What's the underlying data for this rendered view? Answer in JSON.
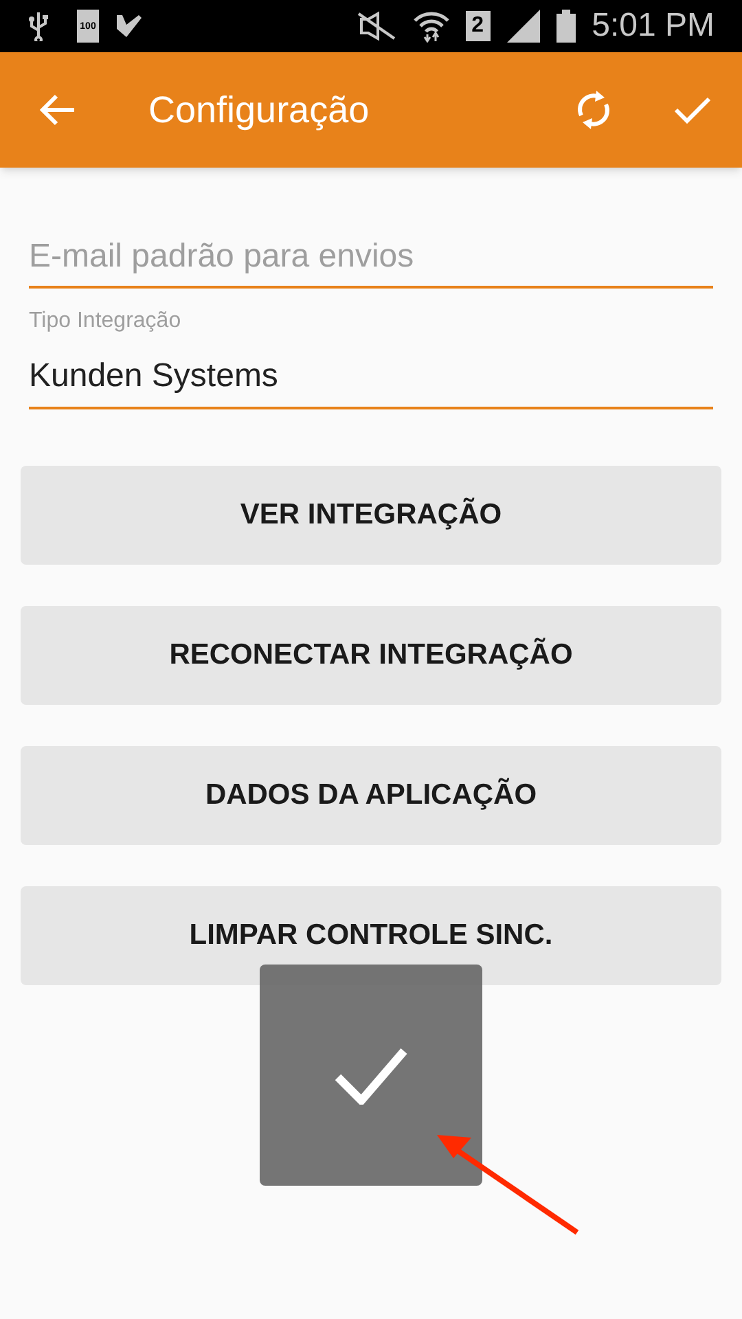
{
  "status_bar": {
    "battery_icon_text": "100",
    "sim_badge": "2",
    "time": "5:01 PM"
  },
  "app_bar": {
    "title": "Configuração"
  },
  "fields": [
    {
      "kind": "empty",
      "placeholder": "E-mail padrão para envios"
    },
    {
      "kind": "filled",
      "label": "Tipo Integração",
      "value": "Kunden Systems"
    }
  ],
  "buttons": [
    "VER INTEGRAÇÃO",
    "RECONECTAR INTEGRAÇÃO",
    "DADOS DA APLICAÇÃO",
    "LIMPAR CONTROLE SINC."
  ],
  "toast": {
    "kind": "success"
  }
}
